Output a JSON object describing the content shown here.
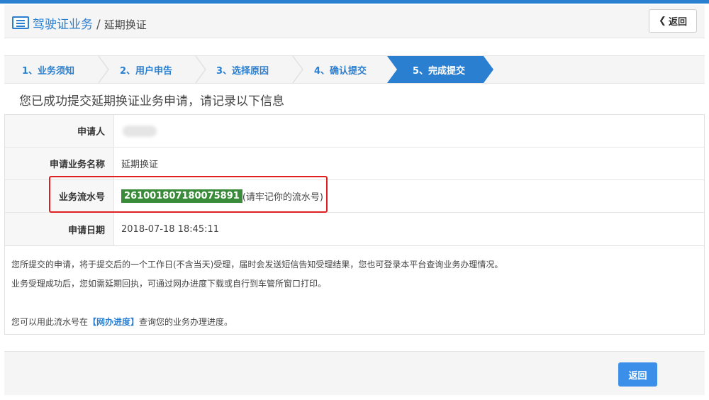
{
  "header": {
    "breadcrumb_root": "驾驶证业务",
    "breadcrumb_sep": "/",
    "breadcrumb_current": "延期换证",
    "back_label": "返回"
  },
  "steps": [
    {
      "label": "1、业务须知",
      "active": false
    },
    {
      "label": "2、用户申告",
      "active": false
    },
    {
      "label": "3、选择原因",
      "active": false
    },
    {
      "label": "4、确认提交",
      "active": false
    },
    {
      "label": "5、完成提交",
      "active": true
    }
  ],
  "success_message": "您已成功提交延期换证业务申请，请记录以下信息",
  "info": {
    "applicant_label": "申请人",
    "business_name_label": "申请业务名称",
    "business_name_value": "延期换证",
    "serial_label": "业务流水号",
    "serial_value": "261001807180075891",
    "serial_note": "(请牢记你的流水号)",
    "date_label": "申请日期",
    "date_value": "2018-07-18 18:45:11"
  },
  "notes": {
    "line1": "您所提交的申请，将于提交后的一个工作日(不含当天)受理，届时会发送短信告知受理结果，您也可登录本平台查询业务办理情况。",
    "line2": "业务受理成功后，您如需延期回执，可通过网办进度下载或自行到车管所窗口打印。",
    "line3_prefix": "您可以用此流水号在",
    "line3_link": "【网办进度】",
    "line3_suffix": "查询您的业务办理进度。"
  },
  "footer": {
    "back_label": "返回"
  },
  "colors": {
    "accent": "#2b7fd0",
    "serial_bg": "#3a8b3a",
    "highlight_border": "#e02020",
    "button_blue": "#3b8fe8"
  },
  "icons": {
    "breadcrumb_icon": "list-document-icon",
    "back_icon": "chevron-left-icon"
  }
}
